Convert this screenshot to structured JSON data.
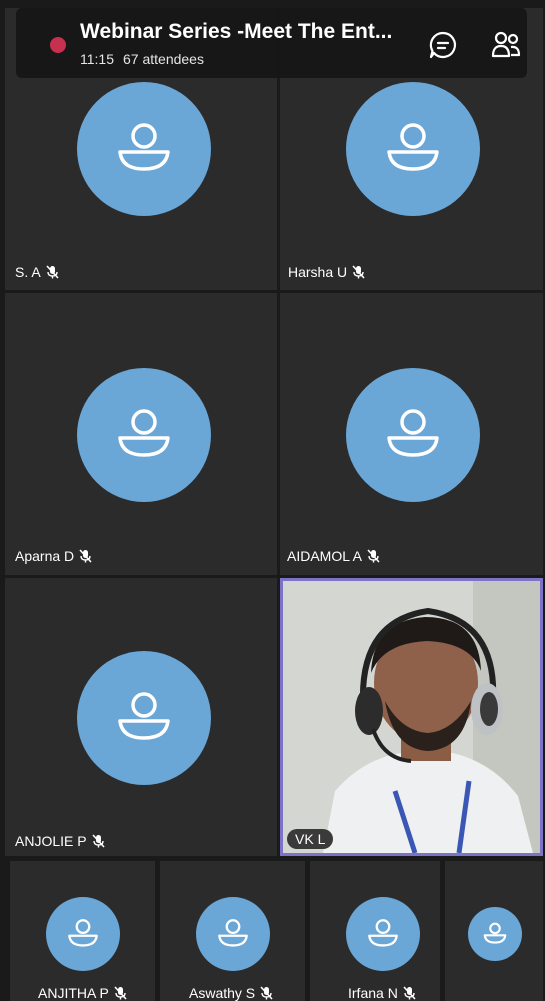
{
  "meeting": {
    "title": "Webinar Series -Meet The Ent...",
    "time": "11:15",
    "attendees": "67 attendees"
  },
  "icons": {
    "chat": "chat-icon",
    "participants": "participants-icon",
    "mic_off": "mic-off-icon",
    "recording": "recording-dot"
  },
  "colors": {
    "avatar": "#6aa6d6",
    "tile": "#2b2b2b",
    "active_border": "#7c72c8",
    "recording": "#c8304f"
  },
  "participants": [
    {
      "name": "S. A"
    },
    {
      "name": "Harsha U"
    },
    {
      "name": "Aparna D"
    },
    {
      "name": "AIDAMOL A"
    },
    {
      "name": "ANJOLIE P"
    },
    {
      "name": "VK L"
    }
  ],
  "bottom_strip": [
    {
      "name": "ANJITHA P"
    },
    {
      "name": "Aswathy S"
    },
    {
      "name": "Irfana N"
    },
    {
      "name": ""
    }
  ]
}
